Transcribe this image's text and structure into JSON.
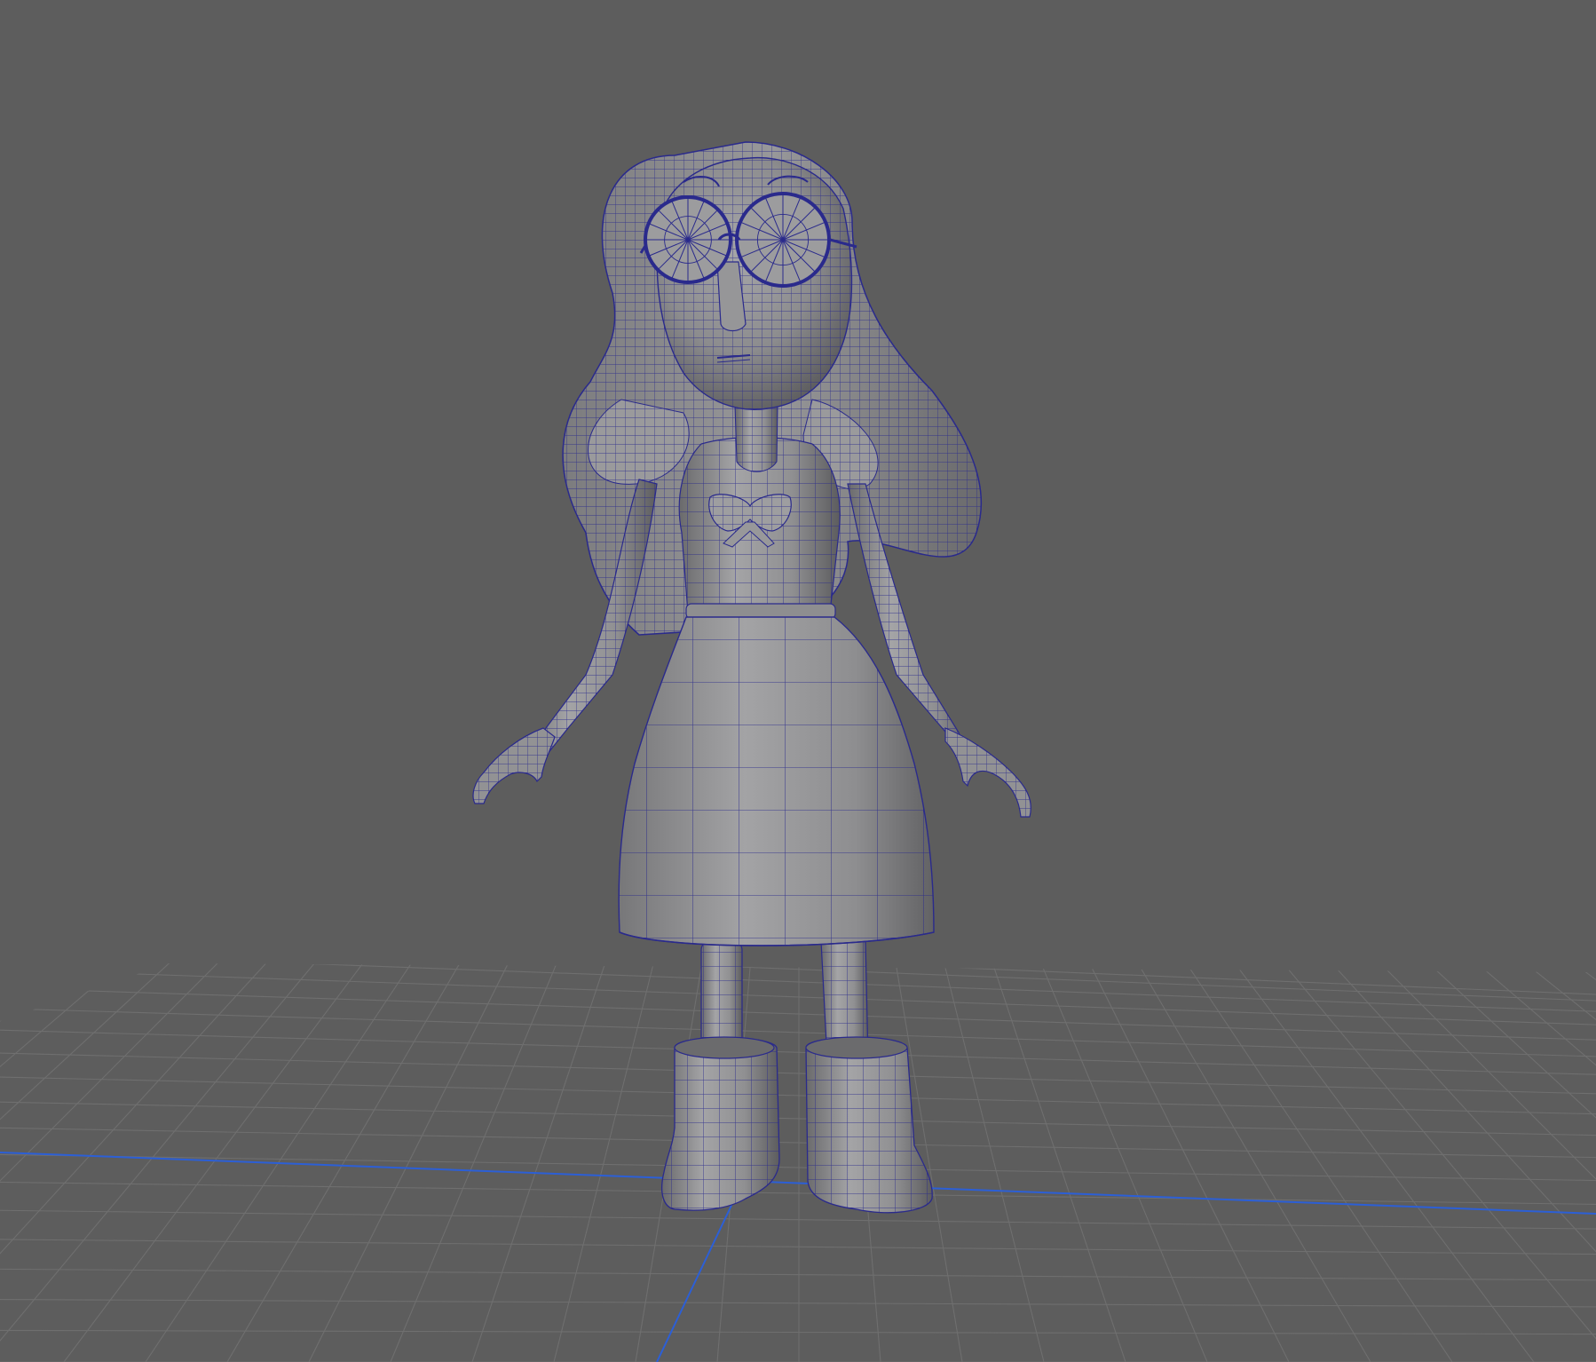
{
  "viewport": {
    "panel": "perspective-viewport",
    "background_color": "#5d5d5d",
    "grid": {
      "visible": true,
      "line_color": "#6f6f6f",
      "axis_color": "#2c5fd6"
    },
    "mesh": {
      "name": "cartoon-girl-character",
      "shading": "smooth-shade-with-wireframe",
      "surface_color": "#8a8a8c",
      "wire_color": "#2a2a8c"
    }
  }
}
